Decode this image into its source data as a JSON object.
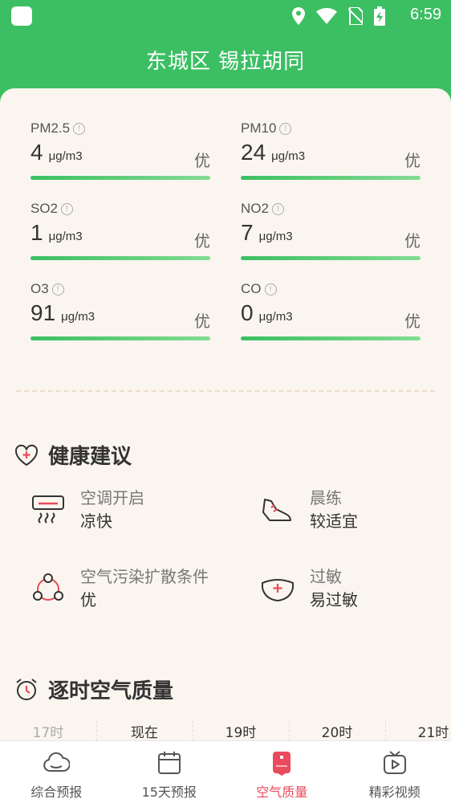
{
  "status_bar": {
    "time": "6:59",
    "icons": [
      "location-icon",
      "wifi-icon",
      "no-sim-icon",
      "battery-charging-icon"
    ]
  },
  "location": "东城区 锡拉胡同",
  "pollutants": [
    {
      "name": "PM2.5",
      "value": "4",
      "unit": "μg/m3",
      "level": "优"
    },
    {
      "name": "PM10",
      "value": "24",
      "unit": "μg/m3",
      "level": "优"
    },
    {
      "name": "SO2",
      "value": "1",
      "unit": "μg/m3",
      "level": "优"
    },
    {
      "name": "NO2",
      "value": "7",
      "unit": "μg/m3",
      "level": "优"
    },
    {
      "name": "O3",
      "value": "91",
      "unit": "μg/m3",
      "level": "优"
    },
    {
      "name": "CO",
      "value": "0",
      "unit": "μg/m3",
      "level": "优"
    }
  ],
  "health": {
    "title": "健康建议",
    "items": [
      {
        "label": "空调开启",
        "value": "凉快",
        "icon": "air-conditioner-icon"
      },
      {
        "label": "晨练",
        "value": "较适宜",
        "icon": "sneaker-icon"
      },
      {
        "label": "空气污染扩散条件",
        "value": "优",
        "icon": "diffusion-icon"
      },
      {
        "label": "过敏",
        "value": "易过敏",
        "icon": "allergy-icon"
      }
    ]
  },
  "hourly": {
    "title": "逐时空气质量",
    "hours": [
      "17时",
      "现在",
      "19时",
      "20时",
      "21时"
    ]
  },
  "tabs": [
    {
      "label": "综合预报",
      "icon": "cloud-icon"
    },
    {
      "label": "15天预报",
      "icon": "calendar-icon"
    },
    {
      "label": "空气质量",
      "icon": "air-quality-icon"
    },
    {
      "label": "精彩视频",
      "icon": "video-icon"
    }
  ],
  "colors": {
    "primary_green": "#3cbf63",
    "accent_red": "#e84b5c",
    "background": "#faf6ef"
  }
}
